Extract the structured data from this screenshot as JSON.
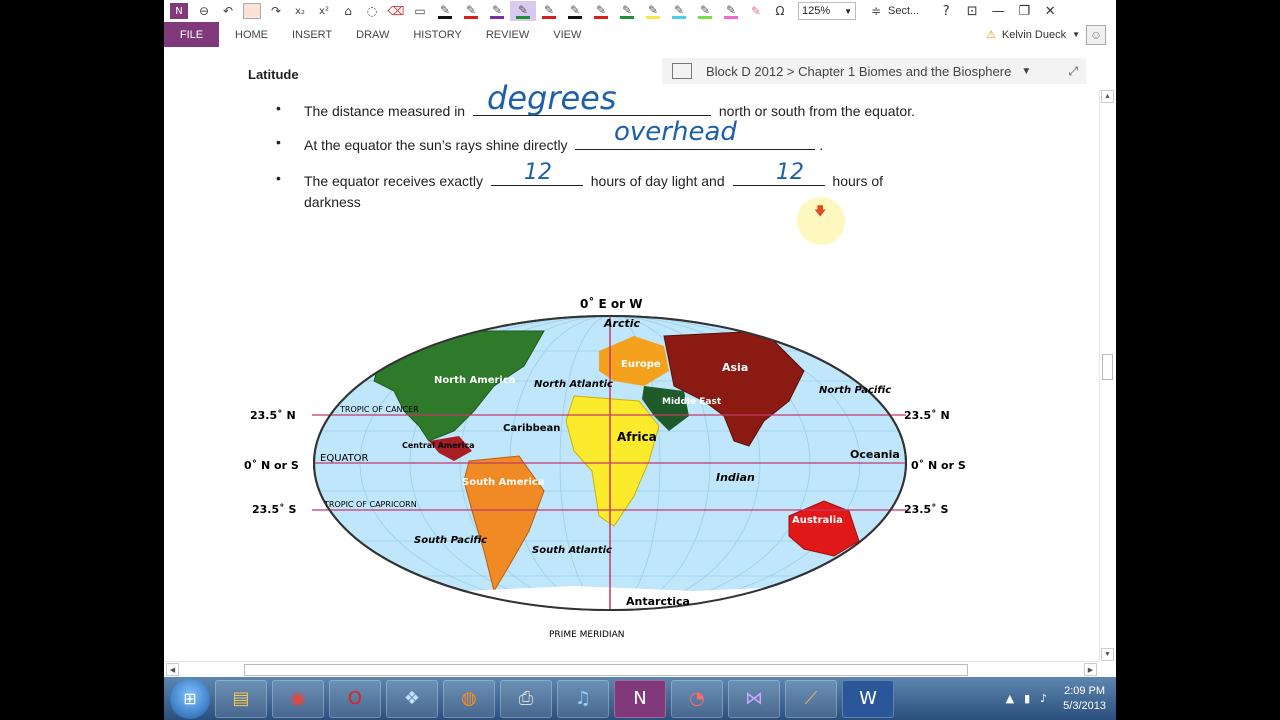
{
  "quick_access": {
    "zoom_value": "125%",
    "section_label": "Sect...",
    "help_label": "?",
    "pen_colors": [
      "#111111",
      "#d91e1e",
      "#7a2f9e",
      "#1f8f3a",
      "#d91e1e",
      "#111111",
      "#d91e1e",
      "#1f8f3a",
      "#f7e84a",
      "#45d0f0",
      "#7de04a",
      "#f06acb"
    ]
  },
  "ribbon": {
    "file_label": "FILE",
    "tabs": [
      "HOME",
      "INSERT",
      "DRAW",
      "HISTORY",
      "REVIEW",
      "VIEW"
    ],
    "user_name": "Kelvin Dueck"
  },
  "breadcrumb": {
    "text": "Block D 2012 > Chapter 1 Biomes and the Biosphere"
  },
  "note": {
    "heading": "Latitude",
    "bullet_glyph": "•",
    "line1": {
      "before": "The distance measured in",
      "after": "north or south from the equator.",
      "handwritten": "degrees"
    },
    "line2": {
      "before": "At the equator the sun’s rays shine directly",
      "after": ".",
      "handwritten": "overhead"
    },
    "line3": {
      "before": "The equator receives exactly",
      "middle": "hours of day light and",
      "after": "hours of",
      "handwritten1": "12",
      "handwritten2": "12"
    },
    "line3_wrap": "darkness"
  },
  "map": {
    "labels": {
      "prime_top": "0˚ E or W",
      "arctic": "Arctic",
      "north_america": "North America",
      "north_atlantic": "North Atlantic",
      "europe": "Europe",
      "asia": "Asia",
      "north_pacific": "North Pacific",
      "middle_east": "Middle East",
      "tropic_cancer": "TROPIC OF CANCER",
      "caribbean": "Caribbean",
      "central_america": "Central America",
      "africa": "Africa",
      "equator": "EQUATOR",
      "oceania": "Oceania",
      "south_america": "South America",
      "indian": "Indian",
      "tropic_capricorn": "TROPIC OF CAPRICORN",
      "australia": "Australia",
      "south_pacific": "South Pacific",
      "south_atlantic": "South Atlantic",
      "antarctica": "Antarctica",
      "prime_meridian": "PRIME MERIDIAN",
      "lat_235n": "23.5˚ N",
      "lat_0": "0˚ N or S",
      "lat_235s": "23.5˚ S"
    }
  },
  "taskbar": {
    "time": "2:09 PM",
    "date": "5/3/2013"
  }
}
